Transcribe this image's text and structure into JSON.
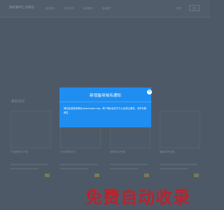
{
  "nav": {
    "logo": "WEBPC.ORG",
    "items": [
      "网站首页",
      "精选文章",
      "网站建设",
      "营销推广"
    ],
    "login": "登录",
    "register": "注册"
  },
  "section_title": "最新资讯",
  "cards": [
    {
      "title": "产品推荐与介绍"
    },
    {
      "title": "行业新闻动态"
    },
    {
      "title": "品牌活动专题"
    },
    {
      "title": "最新发布信息"
    }
  ],
  "modal": {
    "title": "新增备用域名通知",
    "body": "网站此前使用域名www.wuqsc.org，两个网址会在不久以后停止服务，请牢记新域名",
    "close_icon": "close-icon"
  },
  "watermark": "免费自动收录",
  "colors": {
    "modal_bg": "#1f8ef0",
    "overlay": "#4e5967",
    "watermark": "#b8232d"
  }
}
